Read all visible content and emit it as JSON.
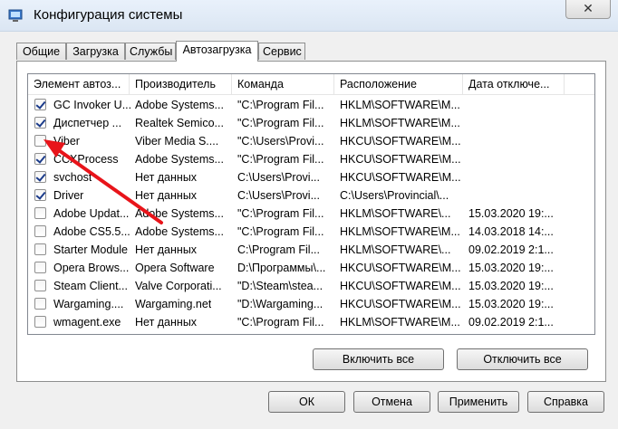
{
  "window": {
    "title": "Конфигурация системы",
    "close_glyph": "✕"
  },
  "tabs": [
    "Общие",
    "Загрузка",
    "Службы",
    "Автозагрузка",
    "Сервис"
  ],
  "active_tab": "Автозагрузка",
  "columns": [
    "Элемент автоз...",
    "Производитель",
    "Команда",
    "Расположение",
    "Дата отключе..."
  ],
  "rows": [
    {
      "checked": true,
      "item": "GC Invoker U...",
      "vendor": "Adobe Systems...",
      "command": "\"C:\\Program Fil...",
      "location": "HKLM\\SOFTWARE\\M...",
      "date": ""
    },
    {
      "checked": true,
      "item": "Диспетчер ...",
      "vendor": "Realtek Semico...",
      "command": "\"C:\\Program Fil...",
      "location": "HKLM\\SOFTWARE\\M...",
      "date": ""
    },
    {
      "checked": false,
      "item": "Viber",
      "vendor": "Viber Media S....",
      "command": "\"C:\\Users\\Provi...",
      "location": "HKCU\\SOFTWARE\\M...",
      "date": ""
    },
    {
      "checked": true,
      "item": "CCXProcess",
      "vendor": "Adobe Systems...",
      "command": "\"C:\\Program Fil...",
      "location": "HKCU\\SOFTWARE\\M...",
      "date": ""
    },
    {
      "checked": true,
      "item": "svchost",
      "vendor": "Нет данных",
      "command": "C:\\Users\\Provi...",
      "location": "HKCU\\SOFTWARE\\M...",
      "date": ""
    },
    {
      "checked": true,
      "item": "Driver",
      "vendor": "Нет данных",
      "command": "C:\\Users\\Provi...",
      "location": "C:\\Users\\Provincial\\...",
      "date": ""
    },
    {
      "checked": false,
      "item": "Adobe Updat...",
      "vendor": "Adobe Systems...",
      "command": "\"C:\\Program Fil...",
      "location": "HKLM\\SOFTWARE\\...",
      "date": "15.03.2020 19:..."
    },
    {
      "checked": false,
      "item": "Adobe CS5.5...",
      "vendor": "Adobe Systems...",
      "command": "\"C:\\Program Fil...",
      "location": "HKLM\\SOFTWARE\\M...",
      "date": "14.03.2018 14:..."
    },
    {
      "checked": false,
      "item": "Starter Module",
      "vendor": "Нет данных",
      "command": "C:\\Program Fil...",
      "location": "HKLM\\SOFTWARE\\...",
      "date": "09.02.2019 2:1..."
    },
    {
      "checked": false,
      "item": "Opera Brows...",
      "vendor": "Opera Software",
      "command": "D:\\Программы\\...",
      "location": "HKCU\\SOFTWARE\\M...",
      "date": "15.03.2020 19:..."
    },
    {
      "checked": false,
      "item": "Steam Client...",
      "vendor": "Valve Corporati...",
      "command": "\"D:\\Steam\\stea...",
      "location": "HKCU\\SOFTWARE\\M...",
      "date": "15.03.2020 19:..."
    },
    {
      "checked": false,
      "item": "Wargaming....",
      "vendor": "Wargaming.net",
      "command": "\"D:\\Wargaming...",
      "location": "HKCU\\SOFTWARE\\M...",
      "date": "15.03.2020 19:..."
    },
    {
      "checked": false,
      "item": "wmagent.exe",
      "vendor": "Нет данных",
      "command": "\"C:\\Program Fil...",
      "location": "HKLM\\SOFTWARE\\M...",
      "date": "09.02.2019 2:1..."
    }
  ],
  "panel_buttons": {
    "enable_all": "Включить все",
    "disable_all": "Отключить все"
  },
  "dialog_buttons": {
    "ok": "ОК",
    "cancel": "Отмена",
    "apply": "Применить",
    "help": "Справка"
  },
  "colors": {
    "annotation_arrow": "#e8141a",
    "check": "#1b3b8a"
  }
}
